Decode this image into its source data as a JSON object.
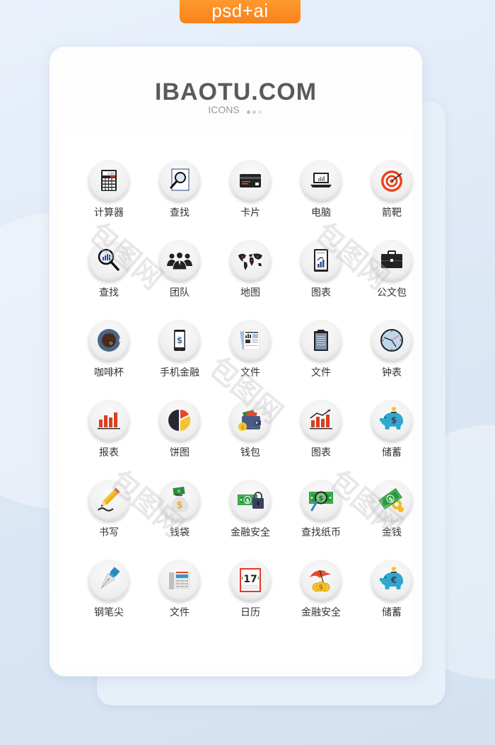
{
  "badge": {
    "label": "psd+ai",
    "color": "#f7821a"
  },
  "header": {
    "brand": "IBAOTU.COM",
    "subtitle": "ICONS",
    "dot_colors": [
      "#bdbdbd",
      "#d0d0d0",
      "#e3e3e3"
    ]
  },
  "icons": [
    {
      "label": "计算器",
      "icon": "calculator-icon"
    },
    {
      "label": "查找",
      "icon": "search-document-icon"
    },
    {
      "label": "卡片",
      "icon": "credit-card-icon"
    },
    {
      "label": "电脑",
      "icon": "laptop-icon"
    },
    {
      "label": "箭靶",
      "icon": "target-icon"
    },
    {
      "label": "查找",
      "icon": "magnifier-chart-icon"
    },
    {
      "label": "团队",
      "icon": "team-icon"
    },
    {
      "label": "地图",
      "icon": "world-map-icon"
    },
    {
      "label": "图表",
      "icon": "tablet-chart-icon"
    },
    {
      "label": "公文包",
      "icon": "briefcase-icon"
    },
    {
      "label": "咖啡杯",
      "icon": "coffee-cup-icon"
    },
    {
      "label": "手机金融",
      "icon": "mobile-finance-icon"
    },
    {
      "label": "文件",
      "icon": "report-document-icon"
    },
    {
      "label": "文件",
      "icon": "clipboard-icon"
    },
    {
      "label": "钟表",
      "icon": "clock-icon"
    },
    {
      "label": "报表",
      "icon": "bar-chart-icon"
    },
    {
      "label": "饼图",
      "icon": "pie-chart-icon"
    },
    {
      "label": "钱包",
      "icon": "wallet-icon"
    },
    {
      "label": "图表",
      "icon": "growth-chart-icon"
    },
    {
      "label": "储蓄",
      "icon": "piggy-bank-dollar-icon"
    },
    {
      "label": "书写",
      "icon": "pencil-icon"
    },
    {
      "label": "钱袋",
      "icon": "money-bag-icon"
    },
    {
      "label": "金融安全",
      "icon": "money-lock-icon"
    },
    {
      "label": "查找纸币",
      "icon": "search-banknote-icon"
    },
    {
      "label": "金钱",
      "icon": "banknote-gear-icon"
    },
    {
      "label": "钢笔尖",
      "icon": "pen-nib-icon"
    },
    {
      "label": "文件",
      "icon": "fax-document-icon"
    },
    {
      "label": "日历",
      "icon": "calendar-icon"
    },
    {
      "label": "金融安全",
      "icon": "umbrella-coins-icon"
    },
    {
      "label": "储蓄",
      "icon": "piggy-bank-euro-icon"
    }
  ],
  "calendar_day": "17",
  "calculator_display": "3.14",
  "watermark": "包图网"
}
